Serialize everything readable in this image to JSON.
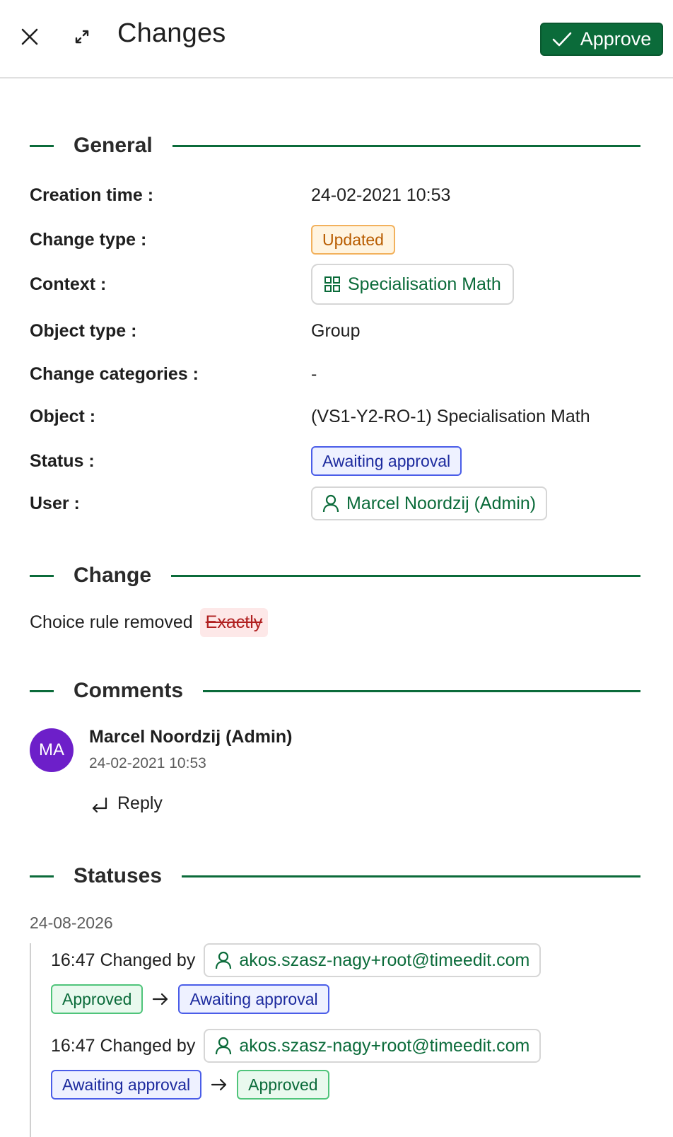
{
  "header": {
    "title": "Changes",
    "approve_label": "Approve"
  },
  "general": {
    "title": "General",
    "rows": [
      {
        "label": "Creation time :",
        "value": "24-02-2021 10:53"
      },
      {
        "label": "Change type :",
        "value": "Updated"
      },
      {
        "label": "Context :",
        "value": "Specialisation Math"
      },
      {
        "label": "Object type :",
        "value": "Group"
      },
      {
        "label": "Change categories :",
        "value": "-"
      },
      {
        "label": "Object :",
        "value": "(VS1-Y2-RO-1) Specialisation Math"
      },
      {
        "label": "Status :",
        "value": "Awaiting approval"
      },
      {
        "label": "User :",
        "value": "Marcel Noordzij (Admin)"
      }
    ]
  },
  "change": {
    "title": "Change",
    "text": "Choice rule removed",
    "removed_value": "Exactly"
  },
  "comments": {
    "title": "Comments",
    "items": [
      {
        "initials": "MA",
        "author": "Marcel Noordzij (Admin)",
        "time": "24-02-2021 10:53",
        "reply_label": "Reply"
      }
    ]
  },
  "statuses": {
    "title": "Statuses",
    "date": "24-08-2026",
    "entries": [
      {
        "text": "16:47 Changed by",
        "user": "akos.szasz-nagy+root@timeedit.com",
        "from": "Approved",
        "to": "Awaiting approval"
      },
      {
        "text": "16:47 Changed by",
        "user": "akos.szasz-nagy+root@timeedit.com",
        "from": "Awaiting approval",
        "to": "Approved"
      }
    ]
  },
  "colors": {
    "accent": "#0b6b3a",
    "avatar": "#6d1fc9",
    "updated": "#f2b15c",
    "awaiting": "#4a5de8",
    "approved": "#4fc47a"
  }
}
